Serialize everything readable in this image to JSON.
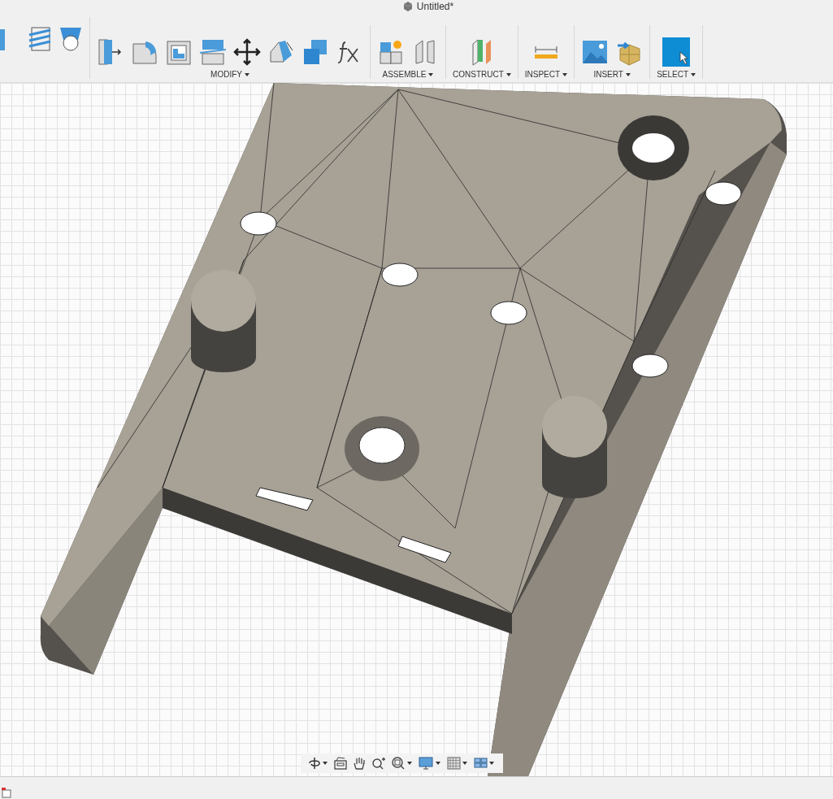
{
  "window": {
    "title": "Untitled*"
  },
  "toolbar": {
    "groups": [
      {
        "label": "MODIFY"
      },
      {
        "label": "ASSEMBLE"
      },
      {
        "label": "CONSTRUCT"
      },
      {
        "label": "INSPECT"
      },
      {
        "label": "INSERT"
      },
      {
        "label": "SELECT"
      }
    ]
  }
}
